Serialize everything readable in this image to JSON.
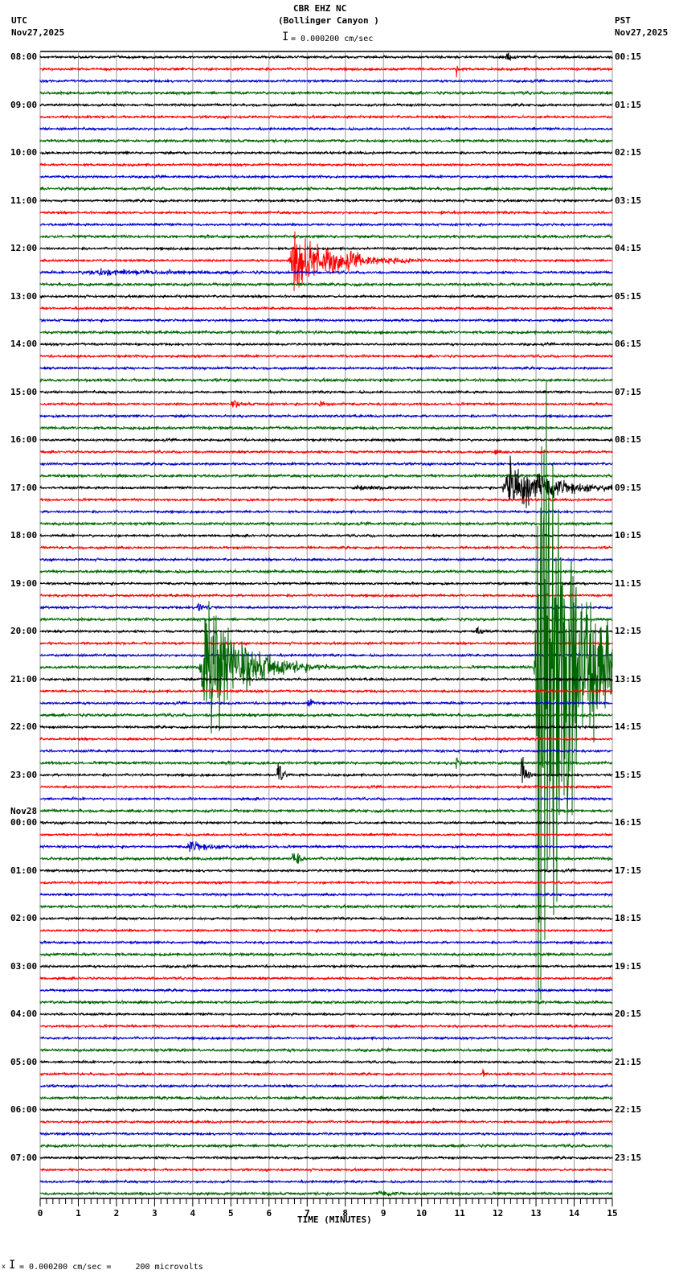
{
  "header": {
    "station": "CBR EHZ NC",
    "location": "(Bollinger Canyon )",
    "scale": "= 0.000200 cm/sec",
    "left_zone": "UTC",
    "left_date": "Nov27,2025",
    "right_zone": "PST",
    "right_date": "Nov27,2025"
  },
  "footer": {
    "scale_note": "= 0.000200 cm/sec =     200 microvolts",
    "marker": "x"
  },
  "chart_data": {
    "type": "line",
    "title": "CBR EHZ NC (Bollinger Canyon )",
    "xlabel": "TIME (MINUTES)",
    "xlim": [
      0,
      15
    ],
    "x_ticks": [
      "0",
      "1",
      "2",
      "3",
      "4",
      "5",
      "6",
      "7",
      "8",
      "9",
      "10",
      "11",
      "12",
      "13",
      "14",
      "15"
    ],
    "traces_per_hour": 4,
    "trace_count": 96,
    "colors": [
      "#000000",
      "#ff0000",
      "#0000cc",
      "#006600"
    ],
    "grid_color": "#999999",
    "left_labels": [
      "08:00",
      "09:00",
      "10:00",
      "11:00",
      "12:00",
      "13:00",
      "14:00",
      "15:00",
      "16:00",
      "17:00",
      "18:00",
      "19:00",
      "20:00",
      "21:00",
      "22:00",
      "23:00",
      "00:00",
      "01:00",
      "02:00",
      "03:00",
      "04:00",
      "05:00",
      "06:00",
      "07:00"
    ],
    "date_change": {
      "hour_index": 16,
      "label": "Nov28"
    },
    "right_labels": [
      "00:15",
      "01:15",
      "02:15",
      "03:15",
      "04:15",
      "05:15",
      "06:15",
      "07:15",
      "08:15",
      "09:15",
      "10:15",
      "11:15",
      "12:15",
      "13:15",
      "14:15",
      "15:15",
      "16:15",
      "17:15",
      "18:15",
      "19:15",
      "20:15",
      "21:15",
      "22:15",
      "23:15"
    ],
    "events": [
      {
        "trace": 0,
        "minute": 12.2,
        "duration": 0.5,
        "amp": 3
      },
      {
        "trace": 1,
        "minute": 10.9,
        "duration": 0.15,
        "amp": 10
      },
      {
        "trace": 13,
        "minute": 10.5,
        "duration": 0.3,
        "amp": 2
      },
      {
        "trace": 17,
        "minute": 6.5,
        "duration": 2.6,
        "amp": 30
      },
      {
        "trace": 18,
        "minute": 1.0,
        "duration": 5.5,
        "amp": 2.5
      },
      {
        "trace": 29,
        "minute": 5.0,
        "duration": 0.6,
        "amp": 3
      },
      {
        "trace": 29,
        "minute": 7.3,
        "duration": 0.4,
        "amp": 4
      },
      {
        "trace": 33,
        "minute": 11.9,
        "duration": 0.2,
        "amp": 5
      },
      {
        "trace": 36,
        "minute": 12.1,
        "duration": 2.9,
        "amp": 25
      },
      {
        "trace": 36,
        "minute": 8.2,
        "duration": 1.5,
        "amp": 2.5
      },
      {
        "trace": 46,
        "minute": 4.1,
        "duration": 0.5,
        "amp": 5
      },
      {
        "trace": 48,
        "minute": 11.4,
        "duration": 0.5,
        "amp": 4
      },
      {
        "trace": 51,
        "minute": 4.15,
        "duration": 2.5,
        "amp": 60
      },
      {
        "trace": 51,
        "minute": 12.95,
        "duration": 2.05,
        "amp": 400
      },
      {
        "trace": 54,
        "minute": 7.0,
        "duration": 0.3,
        "amp": 5
      },
      {
        "trace": 60,
        "minute": 6.2,
        "duration": 0.4,
        "amp": 14
      },
      {
        "trace": 60,
        "minute": 12.6,
        "duration": 0.3,
        "amp": 18
      },
      {
        "trace": 59,
        "minute": 10.9,
        "duration": 0.15,
        "amp": 8
      },
      {
        "trace": 66,
        "minute": 3.8,
        "duration": 1.6,
        "amp": 5
      },
      {
        "trace": 67,
        "minute": 6.6,
        "duration": 0.3,
        "amp": 12
      },
      {
        "trace": 85,
        "minute": 11.6,
        "duration": 0.1,
        "amp": 6
      },
      {
        "trace": 95,
        "minute": 8.8,
        "duration": 1.2,
        "amp": 2
      }
    ]
  }
}
